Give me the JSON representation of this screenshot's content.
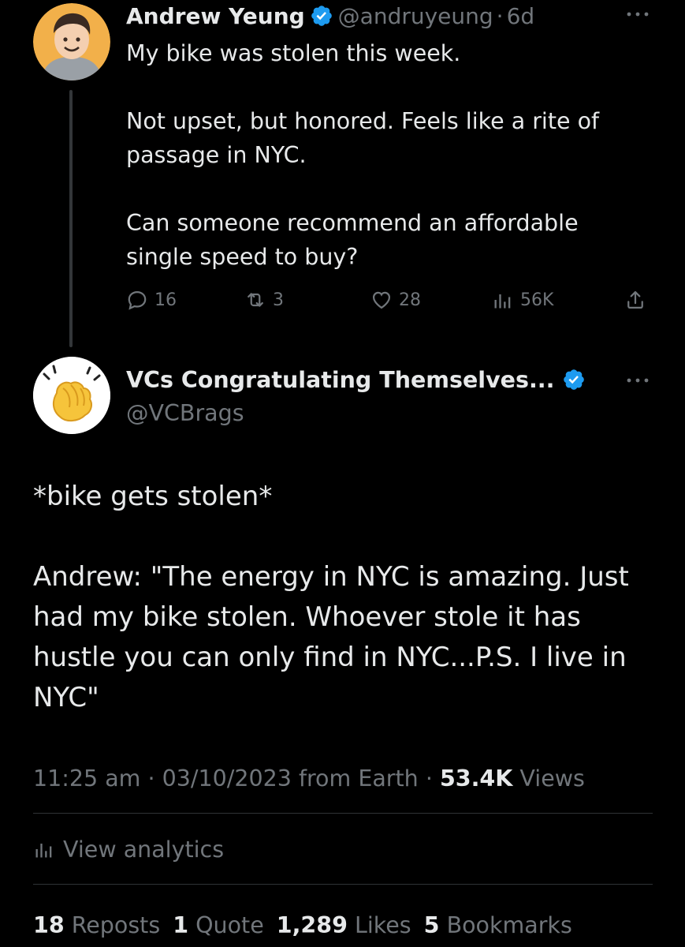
{
  "reply_context": {
    "author_name": "Andrew Yeung",
    "handle": "@andruyeung",
    "separator": "·",
    "age": "6d",
    "body": [
      "My bike was stolen this week.",
      "Not upset, but honored. Feels like a rite of passage in NYC.",
      "Can someone recommend an affordable single speed to buy?"
    ],
    "actions": {
      "replies": "16",
      "reposts": "3",
      "likes": "28",
      "views": "56K"
    },
    "icons": {
      "reply": "reply-icon",
      "repost": "repost-icon",
      "like": "heart-icon",
      "views": "analytics-icon",
      "share": "share-icon",
      "verified": "verified-badge-icon",
      "more": "more-icon"
    }
  },
  "main_tweet": {
    "author_name": "VCs Congratulating Themselves...",
    "handle": "@VCBrags",
    "avatar_emoji": "👏",
    "body": [
      "*bike gets stolen*",
      "Andrew: \"The energy in NYC is amazing. Just had my bike stolen. Whoever stole it has hustle you can only find in NYC...P.S. I live in NYC\""
    ],
    "meta": {
      "time": "11:25 am",
      "date": "03/10/2023",
      "source": "from Earth",
      "views_count": "53.4K",
      "views_label": "Views",
      "sep": "·"
    },
    "analytics_label": "View analytics",
    "stats": {
      "reposts_count": "18",
      "reposts_label": "Reposts",
      "quotes_count": "1",
      "quotes_label": "Quote",
      "likes_count": "1,289",
      "likes_label": "Likes",
      "bookmarks_count": "5",
      "bookmarks_label": "Bookmarks"
    }
  },
  "colors": {
    "background": "#000000",
    "primary_text": "#e7e9ea",
    "secondary_text": "#71767b",
    "verified_blue": "#1d9bf0",
    "divider": "#2f3336"
  }
}
